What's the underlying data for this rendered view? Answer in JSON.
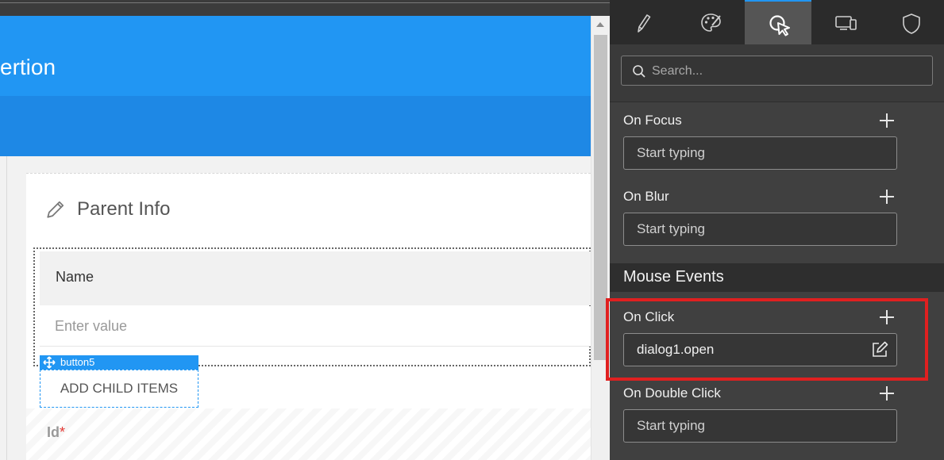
{
  "canvas": {
    "app_title": "ertion",
    "card_title": "Parent Info",
    "name_column": "Name",
    "value_placeholder": "Enter value",
    "selected_tag": "button5",
    "add_child_label": "ADD CHILD ITEMS",
    "id_label": "Id",
    "required_mark": "*"
  },
  "panel": {
    "tabs": [
      {
        "icon": "pencil-icon",
        "active": false
      },
      {
        "icon": "palette-icon",
        "active": false
      },
      {
        "icon": "cursor-click-icon",
        "active": true
      },
      {
        "icon": "devices-icon",
        "active": false
      },
      {
        "icon": "shield-icon",
        "active": false
      }
    ],
    "search_placeholder": "Search...",
    "events": {
      "on_focus": {
        "label": "On Focus",
        "placeholder": "Start typing"
      },
      "on_blur": {
        "label": "On Blur",
        "placeholder": "Start typing"
      },
      "section": "Mouse Events",
      "on_click": {
        "label": "On Click",
        "value": "dialog1.open"
      },
      "on_double_click": {
        "label": "On Double Click",
        "placeholder": "Start typing"
      }
    }
  },
  "colors": {
    "brand_blue": "#2196f3",
    "panel_bg": "#404040",
    "highlight_red": "#e02020"
  }
}
